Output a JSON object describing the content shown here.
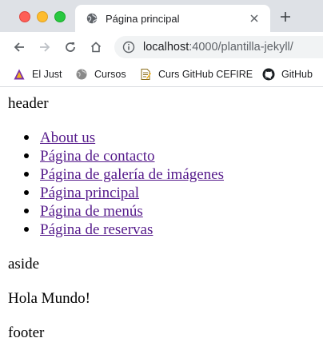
{
  "browser": {
    "tab_title": "Página principal",
    "url_host": "localhost",
    "url_path": ":4000/plantilla-jekyll/",
    "bookmarks": [
      {
        "label": "El Just",
        "icon": "triangle-logo-icon"
      },
      {
        "label": "Cursos",
        "icon": "globe-icon"
      },
      {
        "label": "Curs GitHub CEFIRE",
        "icon": "document-pen-icon"
      },
      {
        "label": "GitHub",
        "icon": "github-icon"
      }
    ]
  },
  "page": {
    "header": "header",
    "menu": [
      "About us",
      "Página de contacto",
      "Página de galería de imágenes",
      "Página principal",
      "Página de menús",
      "Página de reservas"
    ],
    "aside": "aside",
    "content": "Hola Mundo!",
    "footer": "footer"
  },
  "colors": {
    "link_visited": "#551a8b",
    "tabbar_bg": "#dee1e6",
    "omnibox_bg": "#f1f3f4"
  }
}
